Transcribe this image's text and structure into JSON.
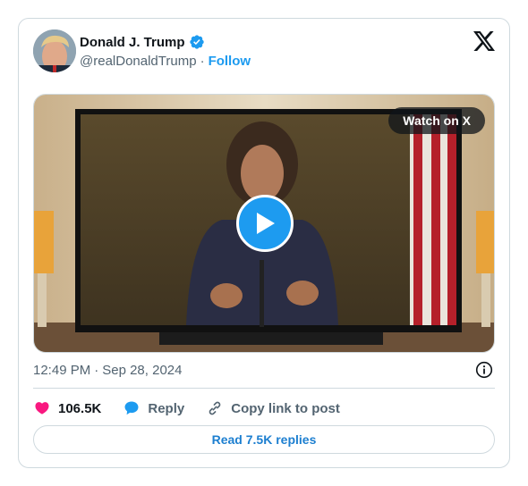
{
  "author": {
    "name": "Donald J. Trump",
    "handle": "@realDonaldTrump",
    "separator": "·",
    "follow_label": "Follow"
  },
  "media": {
    "watch_label": "Watch on X"
  },
  "meta": {
    "time": "12:49 PM",
    "separator": "·",
    "date": "Sep 28, 2024"
  },
  "actions": {
    "likes": "106.5K",
    "reply_label": "Reply",
    "copy_link_label": "Copy link to post"
  },
  "replies_button": "Read 7.5K replies",
  "colors": {
    "accent": "#1d9bf0",
    "like": "#f91880",
    "border": "#cfd9de",
    "muted": "#536471"
  }
}
